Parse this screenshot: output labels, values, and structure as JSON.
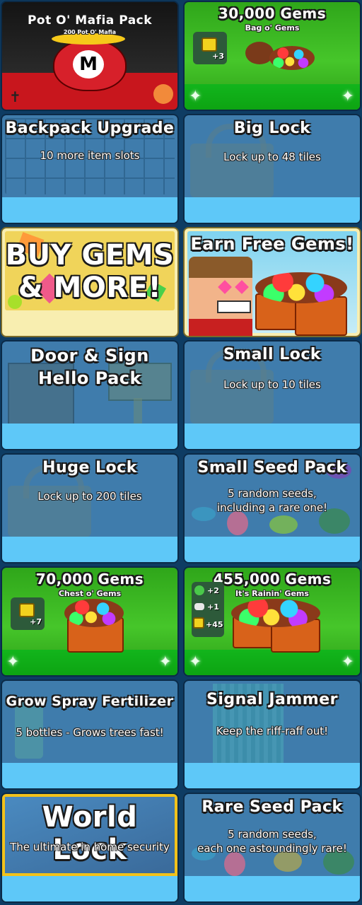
{
  "store": {
    "items": [
      {
        "title": "Pot O' Mafia Pack",
        "subtitle": "200 Pot O' Mafia"
      },
      {
        "title": "30,000 Gems",
        "subtitle": "Bag o' Gems",
        "badge": "+3"
      },
      {
        "title": "Backpack Upgrade",
        "subtitle": "10 more item slots"
      },
      {
        "title": "Big Lock",
        "subtitle": "Lock up to 48 tiles"
      },
      {
        "title_line1": "BUY GEMS",
        "title_line2": "& MORE!"
      },
      {
        "title": "Earn Free Gems!"
      },
      {
        "title_line1": "Door & Sign",
        "title_line2": "Hello Pack"
      },
      {
        "title": "Small Lock",
        "subtitle": "Lock up to 10 tiles"
      },
      {
        "title": "Huge Lock",
        "subtitle": "Lock up to 200 tiles"
      },
      {
        "title": "Small Seed Pack",
        "subtitle_line1": "5 random seeds,",
        "subtitle_line2": "including a rare one!"
      },
      {
        "title": "70,000 Gems",
        "subtitle": "Chest o' Gems",
        "badge": "+7"
      },
      {
        "title": "455,000 Gems",
        "subtitle": "It's Rainin' Gems",
        "badges": [
          "+2",
          "+1",
          "+45"
        ]
      },
      {
        "title": "Grow Spray Fertilizer",
        "subtitle": "5 bottles - Grows trees fast!"
      },
      {
        "title": "Signal Jammer",
        "subtitle": "Keep the riff-raff out!"
      },
      {
        "title": "World Lock",
        "subtitle": "The ultimate in home security"
      },
      {
        "title": "Rare Seed Pack",
        "subtitle_line1": "5 random seeds,",
        "subtitle_line2": "each one astoundingly rare!"
      }
    ]
  },
  "colors": {
    "card_blue": "#3f7cac",
    "footer_blue": "#5ec8f8",
    "gem_green": "#46c62a",
    "mafia_red": "#c8161d",
    "cream": "#f8eeb0"
  }
}
